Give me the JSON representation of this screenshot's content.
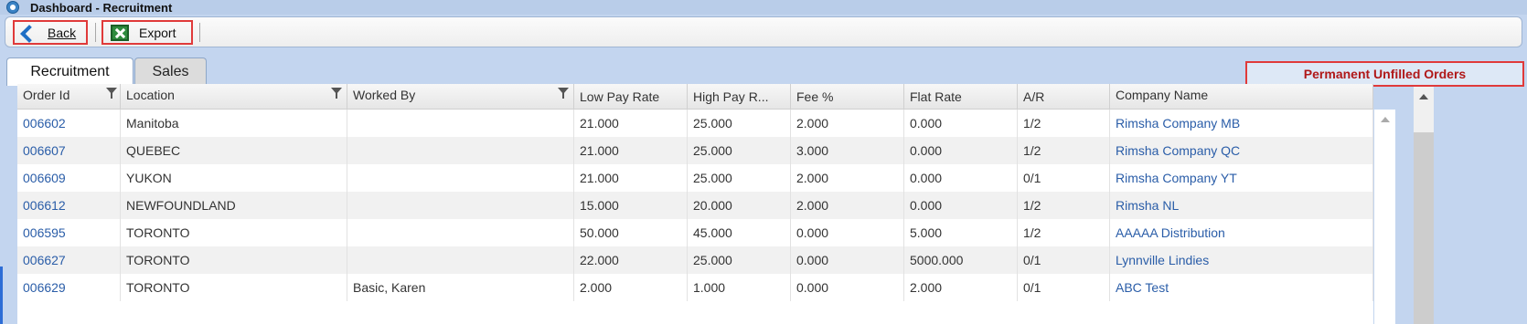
{
  "window": {
    "title": "Dashboard - Recruitment"
  },
  "toolbar": {
    "back_label": "Back",
    "export_label": "Export"
  },
  "tabs": [
    {
      "label": "Recruitment",
      "active": true
    },
    {
      "label": "Sales",
      "active": false
    }
  ],
  "panel_title": "Permanent Unfilled Orders",
  "columns": [
    "Order Id",
    "Location",
    "Worked By",
    "Low Pay Rate",
    "High Pay R...",
    "Fee %",
    "Flat Rate",
    "A/R",
    "Company Name"
  ],
  "rows": [
    [
      "006602",
      "Manitoba",
      "",
      "21.000",
      "25.000",
      "2.000",
      "0.000",
      "1/2",
      "Rimsha Company MB"
    ],
    [
      "006607",
      "QUEBEC",
      "",
      "21.000",
      "25.000",
      "3.000",
      "0.000",
      "1/2",
      "Rimsha Company QC"
    ],
    [
      "006609",
      "YUKON",
      "",
      "21.000",
      "25.000",
      "2.000",
      "0.000",
      "0/1",
      "Rimsha Company YT"
    ],
    [
      "006612",
      "NEWFOUNDLAND",
      "",
      "15.000",
      "20.000",
      "2.000",
      "0.000",
      "1/2",
      "Rimsha NL"
    ],
    [
      "006595",
      "TORONTO",
      "",
      "50.000",
      "45.000",
      "0.000",
      "5.000",
      "1/2",
      "AAAAA Distribution"
    ],
    [
      "006627",
      "TORONTO",
      "",
      "22.000",
      "25.000",
      "0.000",
      "5000.000",
      "0/1",
      "Lynnville Lindies"
    ],
    [
      "006629",
      "TORONTO",
      "Basic, Karen",
      "2.000",
      "1.000",
      "0.000",
      "2.000",
      "0/1",
      "ABC Test"
    ]
  ],
  "icons": {
    "app": "app-icon",
    "back": "back-arrow-icon",
    "export": "excel-icon",
    "filter": "filter-icon"
  },
  "colors": {
    "link": "#2a5da8",
    "highlight_border": "#e03a3a",
    "panel_title": "#b01818"
  }
}
